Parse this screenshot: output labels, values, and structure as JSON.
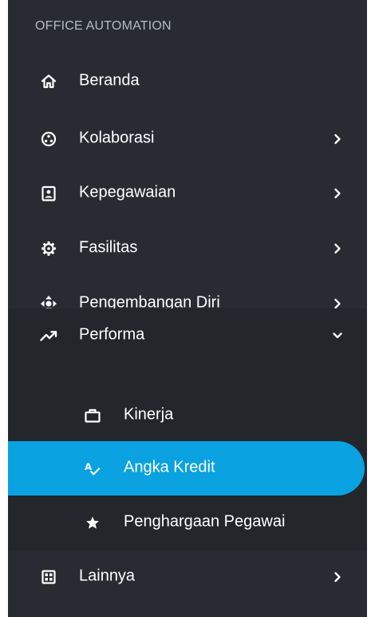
{
  "sidebar": {
    "section_title": "OFFICE AUTOMATION",
    "items": [
      {
        "label": "Beranda",
        "icon": "home-icon",
        "has_chevron": false
      },
      {
        "label": "Kolaborasi",
        "icon": "collaboration-icon",
        "has_chevron": true
      },
      {
        "label": "Kepegawaian",
        "icon": "employee-badge-icon",
        "has_chevron": true
      },
      {
        "label": "Fasilitas",
        "icon": "gear-icon",
        "has_chevron": true
      },
      {
        "label": "Pengembangan Diri",
        "icon": "arrows-move-icon",
        "has_chevron": true
      },
      {
        "label": "Performa",
        "icon": "trending-up-icon",
        "has_chevron": true,
        "expanded": true
      },
      {
        "label": "Lainnya",
        "icon": "grid-icon",
        "has_chevron": true
      }
    ],
    "performa_submenu": [
      {
        "label": "Kinerja",
        "icon": "briefcase-icon",
        "active": false
      },
      {
        "label": "Angka Kredit",
        "icon": "spellcheck-icon",
        "active": true
      },
      {
        "label": "Penghargaan Pegawai",
        "icon": "star-icon",
        "active": false
      }
    ]
  },
  "colors": {
    "sidebar_bg": "#282c32",
    "submenu_bg": "#23272c",
    "active_bg": "#0aa2e0",
    "section_title": "#b6bac2",
    "text": "#ffffff"
  }
}
